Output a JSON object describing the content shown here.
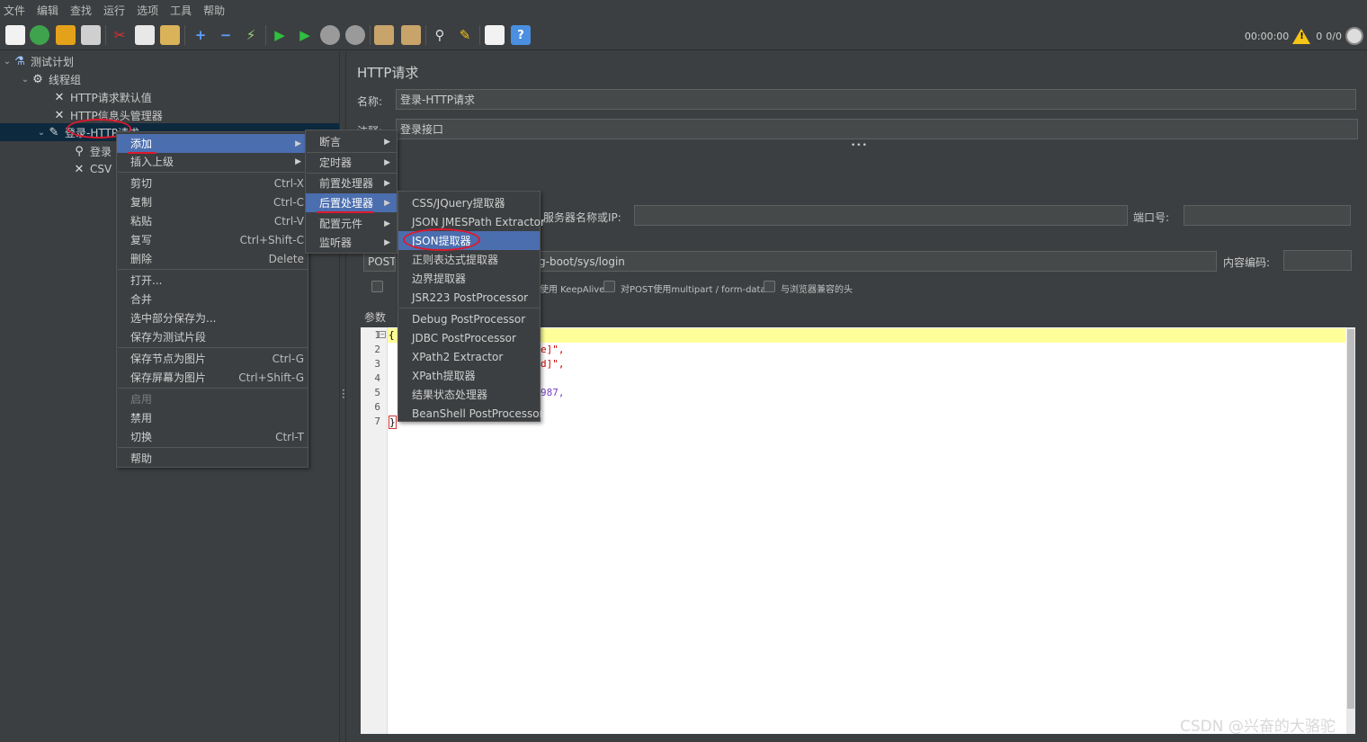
{
  "menubar": [
    "文件",
    "编辑",
    "查找",
    "运行",
    "选项",
    "工具",
    "帮助"
  ],
  "status": {
    "time": "00:00:00",
    "warnings": "0",
    "threads": "0/0"
  },
  "tree": {
    "test_plan": "测试计划",
    "thread_group": "线程组",
    "http_defaults": "HTTP请求默认值",
    "header_manager": "HTTP信息头管理器",
    "selected_sampler": "登录-HTTP请求",
    "child1": "登录",
    "child2": "CSV"
  },
  "form": {
    "title": "HTTP请求",
    "name_label": "名称:",
    "name_value": "登录-HTTP请求",
    "comment_label": "注释:",
    "comment_value": "登录接口",
    "server_label": "服务器名称或IP:",
    "port_label": "端口号:",
    "method": "POST",
    "path_value": "g-boot/sys/login",
    "encoding_label": "内容编码:",
    "opt_keepalive": "使用 KeepAlive",
    "opt_multipart": "对POST使用multipart / form-data",
    "opt_browser": "与浏览器兼容的头",
    "params_tab": "参数"
  },
  "editor": {
    "lines": [
      "1",
      "2",
      "3",
      "4",
      "5",
      "6",
      "7"
    ],
    "line1": "{",
    "line2_tail": "e]\",",
    "line3_tail": "d]\",",
    "line5_tail": "987,",
    "line7": "}"
  },
  "context_menu": {
    "add": "添加",
    "insert_parent": "插入上级",
    "cut": "剪切",
    "cut_sc": "Ctrl-X",
    "copy": "复制",
    "copy_sc": "Ctrl-C",
    "paste": "粘贴",
    "paste_sc": "Ctrl-V",
    "duplicate": "复写",
    "duplicate_sc": "Ctrl+Shift-C",
    "delete": "删除",
    "delete_sc": "Delete",
    "open": "打开...",
    "merge": "合并",
    "save_selection": "选中部分保存为...",
    "save_fragment": "保存为测试片段",
    "save_node_image": "保存节点为图片",
    "save_node_image_sc": "Ctrl-G",
    "save_screen_image": "保存屏幕为图片",
    "save_screen_image_sc": "Ctrl+Shift-G",
    "enable": "启用",
    "disable": "禁用",
    "toggle": "切换",
    "toggle_sc": "Ctrl-T",
    "help": "帮助"
  },
  "add_submenu": [
    "断言",
    "定时器",
    "前置处理器",
    "后置处理器",
    "配置元件",
    "监听器"
  ],
  "post_processors": [
    "CSS/JQuery提取器",
    "JSON JMESPath Extractor",
    "JSON提取器",
    "正则表达式提取器",
    "边界提取器",
    "JSR223 PostProcessor",
    "Debug PostProcessor",
    "JDBC PostProcessor",
    "XPath2 Extractor",
    "XPath提取器",
    "结果状态处理器",
    "BeanShell PostProcessor"
  ],
  "colors": {
    "highlight": "#4b6eaf",
    "annotation": "#e0182d",
    "background": "#3c3f41"
  },
  "watermark": "CSDN @兴奋的大骆驼"
}
